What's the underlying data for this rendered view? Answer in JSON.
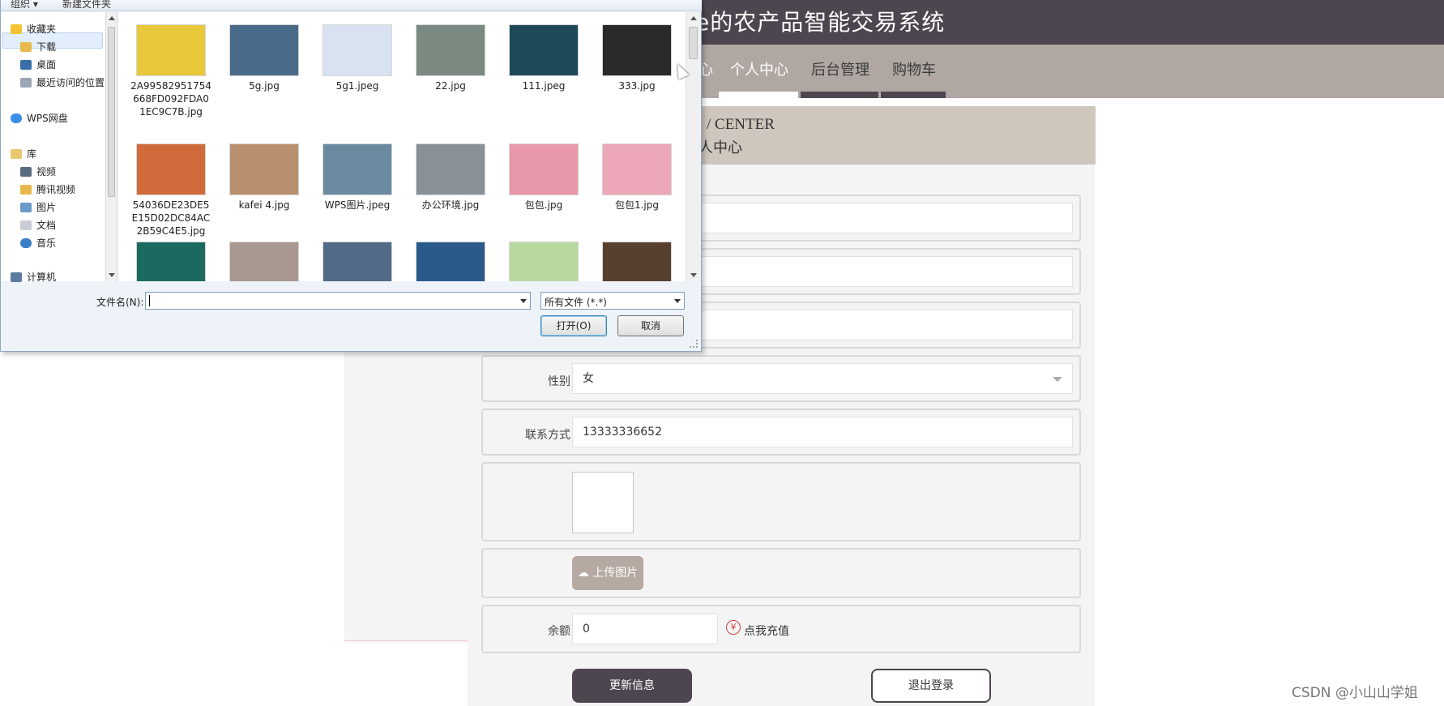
{
  "site": {
    "title": "e的农产品智能交易系统",
    "nav": [
      "个人中心",
      "后台管理",
      "购物车"
    ],
    "nav_cut": "心",
    "banner_en": "/ CENTER",
    "banner_cn": "人中心",
    "colors": {
      "header": "#4d454f",
      "nav": "#b0a7a3",
      "banner": "#cfc6bd",
      "button": "#4d454f"
    }
  },
  "form": {
    "gender_label": "性别",
    "gender_value": "女",
    "contact_label": "联系方式",
    "contact_value": "13333336652",
    "upload_label": "上传图片",
    "upload_icon": "cloud-upload-icon",
    "balance_label": "余额",
    "balance_value": "0",
    "recharge_icon": "yen-icon",
    "recharge_text": "点我充值",
    "update_button": "更新信息",
    "logout_button": "退出登录"
  },
  "dialog": {
    "toolbar": [
      "组织 ▾",
      "新建文件夹"
    ],
    "nav_items": [
      {
        "label": "收藏夹",
        "icon": "star-icon"
      },
      {
        "label": "下载",
        "icon": "download-folder-icon"
      },
      {
        "label": "桌面",
        "icon": "desktop-icon"
      },
      {
        "label": "最近访问的位置",
        "icon": "recent-icon"
      },
      {
        "label": "WPS网盘",
        "icon": "cloud-icon"
      },
      {
        "label": "库",
        "icon": "library-icon"
      },
      {
        "label": "视频",
        "icon": "video-icon"
      },
      {
        "label": "腾讯视频",
        "icon": "folder-icon"
      },
      {
        "label": "图片",
        "icon": "picture-icon"
      },
      {
        "label": "文档",
        "icon": "document-icon"
      },
      {
        "label": "音乐",
        "icon": "music-icon"
      },
      {
        "label": "计算机",
        "icon": "computer-icon"
      }
    ],
    "files": [
      {
        "name": "2A99582951754668FD092FDA01EC9C7B.jpg",
        "color": "#e8c83a"
      },
      {
        "name": "5g.jpg",
        "color": "#4a6a8a"
      },
      {
        "name": "5g1.jpeg",
        "color": "#d8e2f0"
      },
      {
        "name": "22.jpg",
        "color": "#7a8a80"
      },
      {
        "name": "111.jpeg",
        "color": "#1e4a58"
      },
      {
        "name": "333.jpg",
        "color": "#2a2a2a"
      },
      {
        "name": "54036DE23DE5E15D02DC84AC2B59C4E5.jpg",
        "color": "#d06a3a"
      },
      {
        "name": "kafei 4.jpg",
        "color": "#b89070"
      },
      {
        "name": "WPS图片.jpeg",
        "color": "#6a8aa0"
      },
      {
        "name": "办公环境.jpg",
        "color": "#8a9098"
      },
      {
        "name": "包包.jpg",
        "color": "#e898a8"
      },
      {
        "name": "包包1.jpg",
        "color": "#eca8b8"
      },
      {
        "name": "",
        "color": "#1a6a60"
      },
      {
        "name": "",
        "color": "#a89890"
      },
      {
        "name": "",
        "color": "#506a88"
      },
      {
        "name": "",
        "color": "#2a5a8a"
      },
      {
        "name": "",
        "color": "#b8d8a0"
      },
      {
        "name": "",
        "color": "#584030"
      }
    ],
    "filename_label": "文件名(N):",
    "filename_value": "",
    "filetype_value": "所有文件 (*.*)",
    "open_button": "打开(O)",
    "cancel_button": "取消"
  },
  "watermark": "CSDN @小山山学姐"
}
